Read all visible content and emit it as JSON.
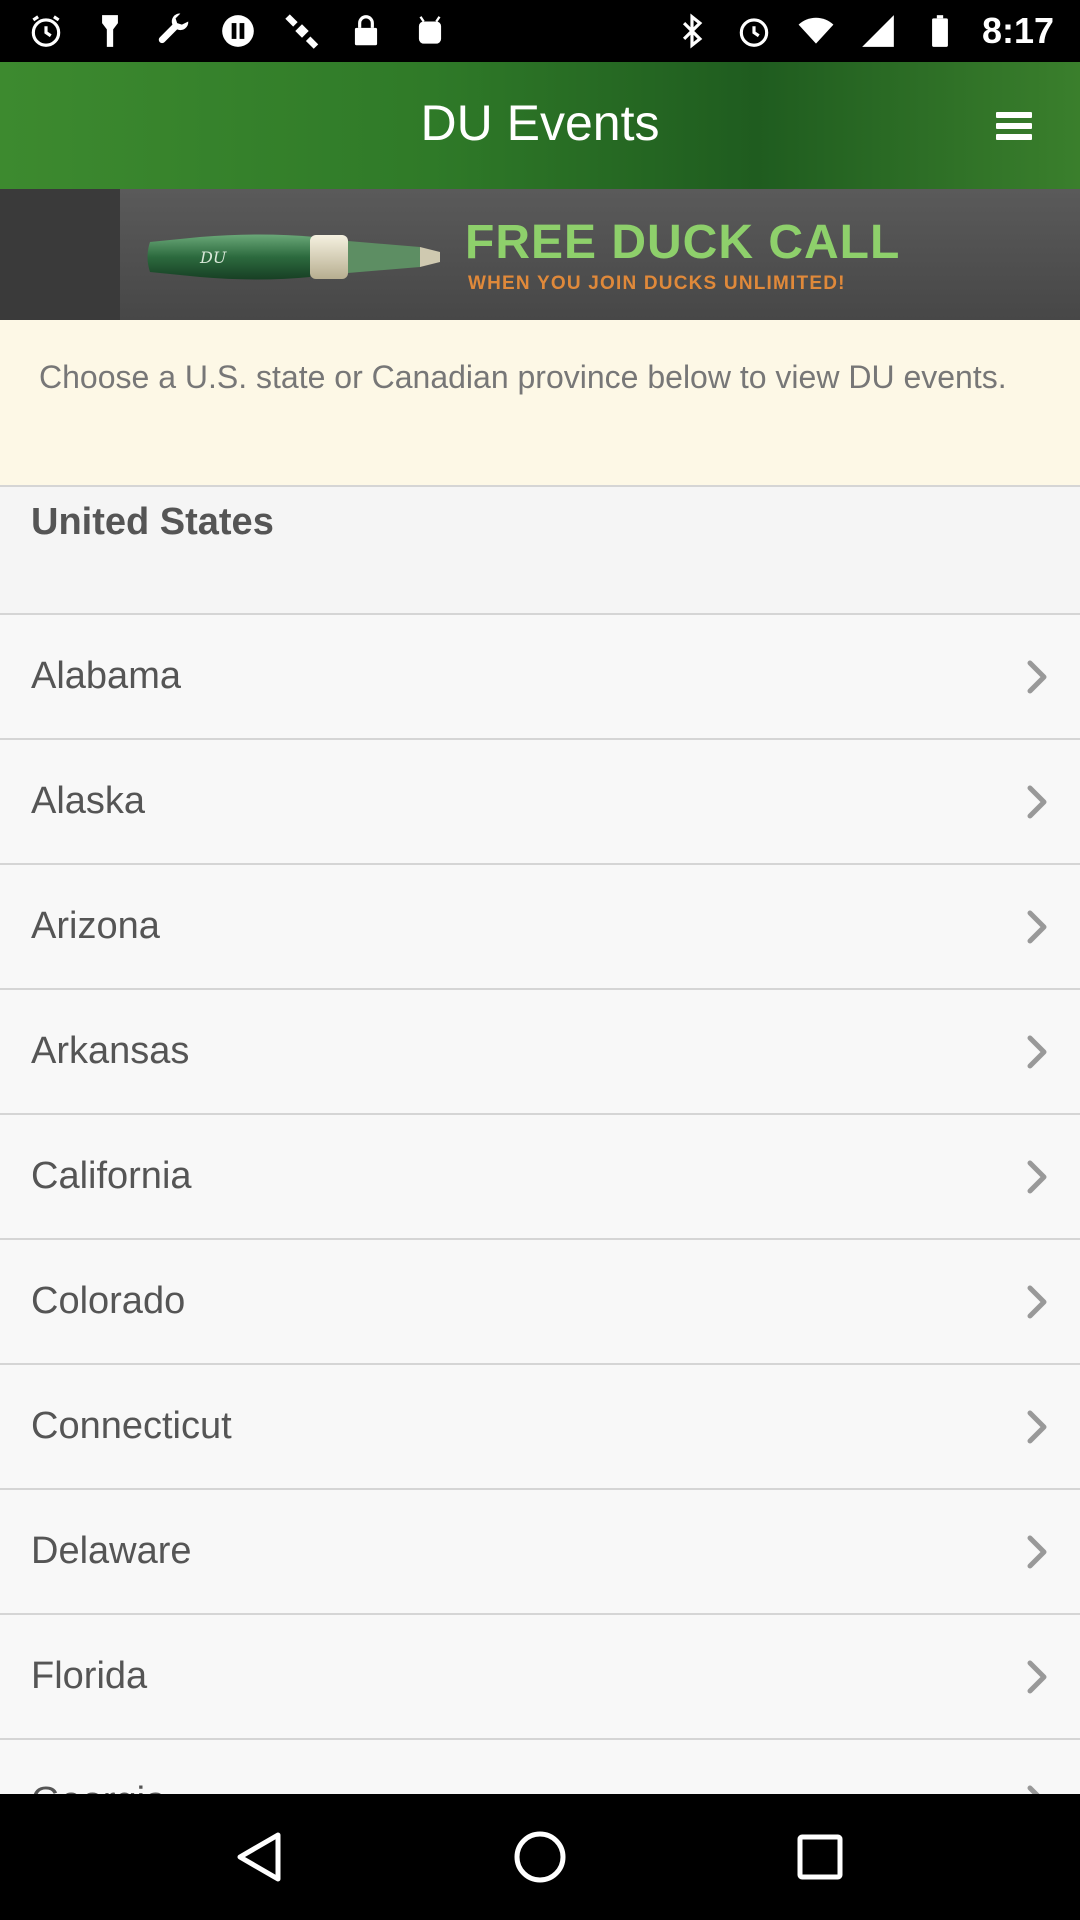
{
  "status_bar": {
    "time": "8:17",
    "left_icons": [
      "alarm-icon",
      "flashlight-icon",
      "wrench-icon",
      "pause-icon",
      "satellite-icon",
      "lock-icon",
      "android-icon"
    ],
    "right_icons": [
      "bluetooth-icon",
      "alarm-icon",
      "wifi-icon",
      "signal-icon",
      "battery-icon"
    ]
  },
  "header": {
    "title": "DU Events",
    "menu_icon": "hamburger-menu-icon"
  },
  "ad": {
    "headline": "FREE DUCK CALL",
    "subline": "WHEN YOU JOIN DUCKS UNLIMITED!"
  },
  "intro": {
    "text": "Choose a U.S. state or Canadian province below to view DU events."
  },
  "section": {
    "title": "United States"
  },
  "states": [
    {
      "label": "Alabama"
    },
    {
      "label": "Alaska"
    },
    {
      "label": "Arizona"
    },
    {
      "label": "Arkansas"
    },
    {
      "label": "California"
    },
    {
      "label": "Colorado"
    },
    {
      "label": "Connecticut"
    },
    {
      "label": "Delaware"
    },
    {
      "label": "Florida"
    },
    {
      "label": "Georgia"
    }
  ],
  "nav": {
    "back_icon": "back-triangle-icon",
    "home_icon": "home-circle-icon",
    "recents_icon": "recents-square-icon"
  },
  "colors": {
    "header_green": "#2f7a28",
    "ad_green": "#8ed06b",
    "ad_orange": "#e0893a",
    "intro_bg": "#fdf8e6"
  }
}
